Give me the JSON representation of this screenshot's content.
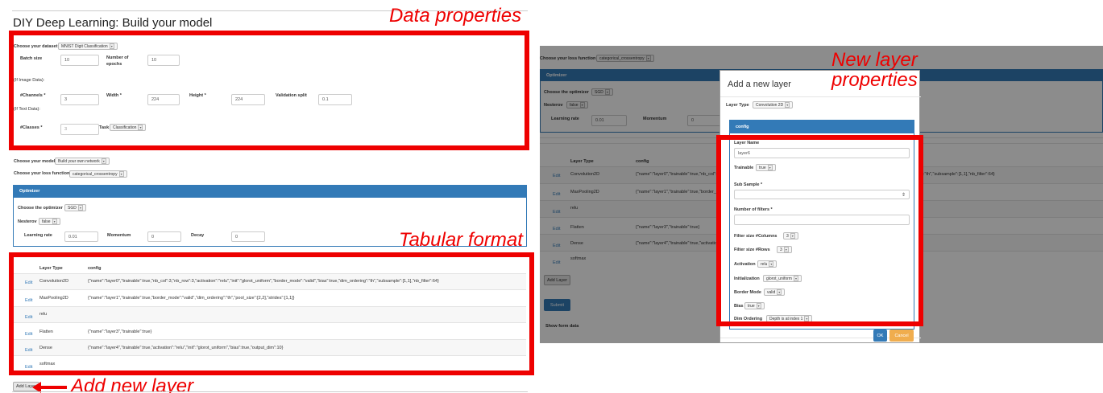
{
  "annotations": {
    "data_properties": "Data properties",
    "tabular_format": "Tabular format",
    "add_new_layer": "Add new layer",
    "new_layer_properties_1": "New layer",
    "new_layer_properties_2": "properties"
  },
  "left": {
    "title": "DIY Deep Learning: Build your model",
    "dataset_label": "Choose your dataset",
    "dataset_value": "MNIST Digit Classification",
    "batch_size_label": "Batch size",
    "batch_size_value": "10",
    "epochs_label_1": "Number of",
    "epochs_label_2": "epochs",
    "epochs_value": "10",
    "if_image": "(If Image Data):",
    "channels_label": "#Channels *",
    "channels_value": "3",
    "width_label": "Width *",
    "width_value": "224",
    "height_label": "Height *",
    "height_value": "224",
    "validation_label": "Validation split",
    "validation_value": "0.1",
    "if_text": "(If Text Data):",
    "classes_label": "#Classes *",
    "classes_value": "3",
    "task_label": "Task",
    "task_value": "Classification",
    "model_label": "Choose your model",
    "model_value": "Build your own network",
    "loss_label": "Choose your loss function",
    "loss_value": "categorical_crossentropy",
    "optimizer_head": "Optimizer",
    "optimizer_label": "Choose the optimizer",
    "optimizer_value": "SGD",
    "nesterov_label": "Nesterov",
    "nesterov_value": "false",
    "lr_label": "Learning rate",
    "lr_value": "0.01",
    "momentum_label": "Momentum",
    "momentum_value": "0",
    "decay_label": "Decay",
    "decay_value": "0",
    "table_head_type": "Layer Type",
    "table_head_config": "config",
    "edit_label": "Edit",
    "rows": [
      {
        "type": "Convolution2D",
        "config": "{\"name\":\"layer0\",\"trainable\":true,\"nb_col\":3,\"nb_row\":3,\"activation\":\"relu\",\"init\":\"glorot_uniform\",\"border_mode\":\"valid\",\"bias\":true,\"dim_ordering\":\"th\",\"subsample\":[1,1],\"nb_filter\":64}"
      },
      {
        "type": "MaxPooling2D",
        "config": "{\"name\":\"layer1\",\"trainable\":true,\"border_mode\":\"valid\",\"dim_ordering\":\"th\",\"pool_size\":[2,2],\"strides\":[1,1]}"
      },
      {
        "type": "relu",
        "config": ""
      },
      {
        "type": "Flatten",
        "config": "{\"name\":\"layer3\",\"trainable\":true}"
      },
      {
        "type": "Dense",
        "config": "{\"name\":\"layer4\",\"trainable\":true,\"activation\":\"relu\",\"init\":\"glorot_uniform\",\"bias\":true,\"output_dim\":10}"
      },
      {
        "type": "softmax",
        "config": ""
      }
    ],
    "add_layer_label": "Add Layer"
  },
  "right": {
    "loss_label": "Choose your loss function",
    "loss_value": "categorical_crossentropy",
    "optimizer_head": "Optimizer",
    "optimizer_label": "Choose the optimizer",
    "optimizer_value": "SGD",
    "nesterov_label": "Nesterov",
    "nesterov_value": "false",
    "lr_label": "Learning rate",
    "lr_value": "0.01",
    "momentum_label": "Momentum",
    "momentum_value": "0",
    "table_head_type": "Layer Type",
    "table_head_config": "config",
    "edit_label": "Edit",
    "rows": [
      {
        "type": "Convolution2D",
        "config": "{\"name\":\"layer0\",\"trainable\":true,\"nb_col\":3,"
      },
      {
        "type": "MaxPooling2D",
        "config": "{\"name\":\"layer1\",\"trainable\":true,\"border_mo"
      },
      {
        "type": "relu",
        "config": ""
      },
      {
        "type": "Flatten",
        "config": "{\"name\":\"layer3\",\"trainable\":true}"
      },
      {
        "type": "Dense",
        "config": "{\"name\":\"layer4\",\"trainable\":true,\"activation\":"
      },
      {
        "type": "softmax",
        "config": ""
      }
    ],
    "row0_tail": ":\"th\",\"subsample\":[1,1],\"nb_filter\":64}",
    "add_layer_label": "Add Layer",
    "submit_label": "Submit",
    "show_form_data": "Show form data"
  },
  "modal": {
    "title": "Add a new layer",
    "layer_type_label": "Layer Type",
    "layer_type_value": "Convolution 2D",
    "config_head": "config",
    "layer_name_label": "Layer Name",
    "layer_name_value": "layer6",
    "trainable_label": "Trainable",
    "trainable_value": "true",
    "subsample_label": "Sub Sample *",
    "filters_label": "Number of filters *",
    "filter_cols_label": "Filter size #Columns",
    "filter_cols_value": "3",
    "filter_rows_label": "Filter size #Rows",
    "filter_rows_value": "3",
    "activation_label": "Activation",
    "activation_value": "relu",
    "init_label": "Initialization",
    "init_value": "glorot_uniform",
    "border_label": "Border Mode",
    "border_value": "valid",
    "bias_label": "Bias",
    "bias_value": "true",
    "dim_label": "Dim Ordering",
    "dim_value": "Depth is at index 1",
    "ok_label": "OK",
    "cancel_label": "Cancel"
  },
  "colors": {
    "annotation_red": "#ee0000",
    "panel_blue": "#337ab7",
    "ok_blue": "#337ab7",
    "cancel_orange": "#f0ad4e"
  }
}
